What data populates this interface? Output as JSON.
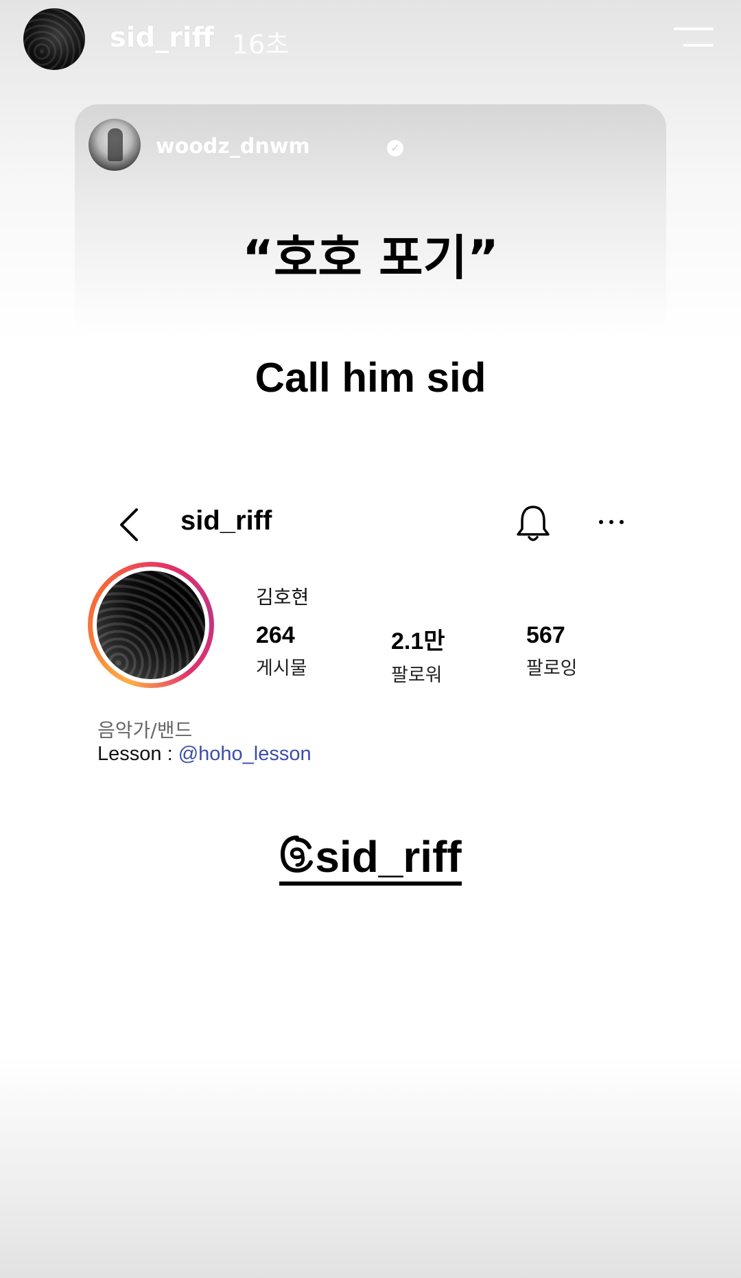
{
  "story": {
    "username": "sid_riff",
    "time": "16초"
  },
  "shared_post": {
    "username": "woodz_dnwm",
    "quote": "“호호 포기”"
  },
  "caption": "Call him sid",
  "profile": {
    "username": "sid_riff",
    "full_name": "김호현",
    "stats": [
      {
        "value": "264",
        "label": "게시물"
      },
      {
        "value": "2.1만",
        "label": "팔로워"
      },
      {
        "value": "567",
        "label": "팔로잉"
      }
    ],
    "category": "음악가/밴드",
    "bio_prefix": "Lesson : ",
    "bio_link": "@hoho_lesson"
  },
  "threads": {
    "handle": "sid_riff"
  },
  "icons": {
    "menu": "menu-icon",
    "verified": "verified-badge-icon",
    "back": "chevron-left-icon",
    "bell": "bell-icon",
    "more": "more-horizontal-icon",
    "threads": "threads-logo-icon"
  },
  "colors": {
    "link": "#3b4ea8",
    "ring_start": "#fcaf45",
    "ring_end": "#c13584"
  }
}
